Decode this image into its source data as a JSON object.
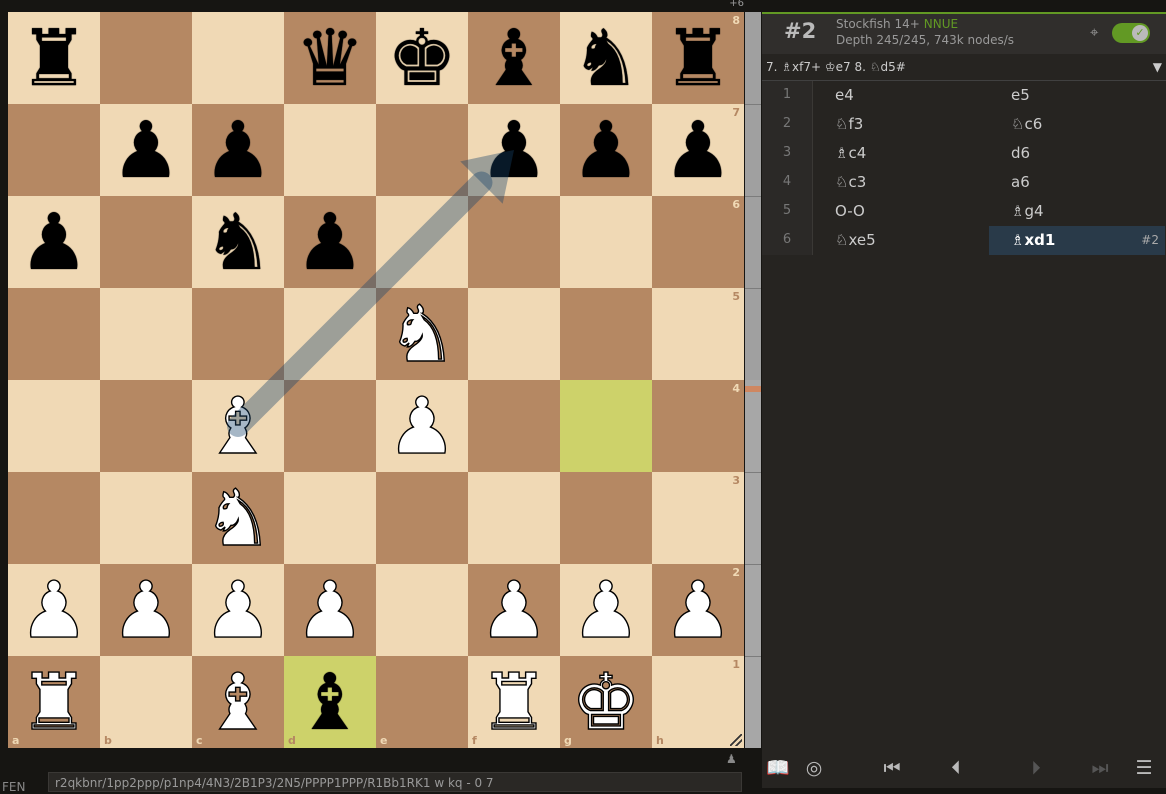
{
  "board": {
    "ranks": [
      [
        "r",
        "",
        "",
        "q",
        "k",
        "b",
        "n",
        "r"
      ],
      [
        "",
        "p",
        "p",
        "",
        "",
        "p",
        "p",
        "p"
      ],
      [
        "p",
        "",
        "n",
        "p",
        "",
        "",
        "",
        ""
      ],
      [
        "",
        "",
        "",
        "",
        "N",
        "",
        "",
        ""
      ],
      [
        "",
        "",
        "B",
        "",
        "P",
        "",
        "",
        ""
      ],
      [
        "",
        "",
        "N",
        "",
        "",
        "",
        "",
        ""
      ],
      [
        "P",
        "P",
        "P",
        "P",
        "",
        "P",
        "P",
        "P"
      ],
      [
        "R",
        "",
        "B",
        "b",
        "",
        "R",
        "K",
        ""
      ]
    ],
    "highlights": [
      "g4",
      "d1"
    ],
    "arrow": {
      "from": "c4",
      "to": "f7"
    },
    "rank_labels": [
      "8",
      "7",
      "6",
      "5",
      "4",
      "3",
      "2",
      "1"
    ],
    "file_labels": [
      "a",
      "b",
      "c",
      "d",
      "e",
      "f",
      "g",
      "h"
    ],
    "top_indicator": "+6"
  },
  "gauge": {
    "white_share": 0.5
  },
  "engine": {
    "score": "#2",
    "name": "Stockfish 14+",
    "nnue": "NNUE",
    "depth": "Depth 245/245, 743k nodes/s",
    "enabled": true,
    "pv": "7. ♗xf7+ ♔e7 8. ♘d5#"
  },
  "moves": [
    {
      "num": "1",
      "white": "e4",
      "black": "e5"
    },
    {
      "num": "2",
      "white": "♘f3",
      "black": "♘c6"
    },
    {
      "num": "3",
      "white": "♗c4",
      "black": "d6"
    },
    {
      "num": "4",
      "white": "♘c3",
      "black": "a6"
    },
    {
      "num": "5",
      "white": "O-O",
      "black": "♗g4"
    },
    {
      "num": "6",
      "white": "♘xe5",
      "black": "♗xd1",
      "black_badge": "#2",
      "active": "black"
    }
  ],
  "fen": {
    "label": "FEN",
    "value": "r2qkbnr/1pp2ppp/p1np4/4N3/2B1P3/2N5/PPPP1PPP/R1Bb1RK1 w kq - 0 7"
  },
  "icons": {
    "target": "target-icon",
    "toggle_check": "check-icon",
    "book": "book-icon",
    "practice": "practice-target-icon",
    "first": "first-move-icon",
    "prev": "prev-move-icon",
    "next": "next-move-icon",
    "last": "last-move-icon",
    "menu": "menu-icon"
  }
}
